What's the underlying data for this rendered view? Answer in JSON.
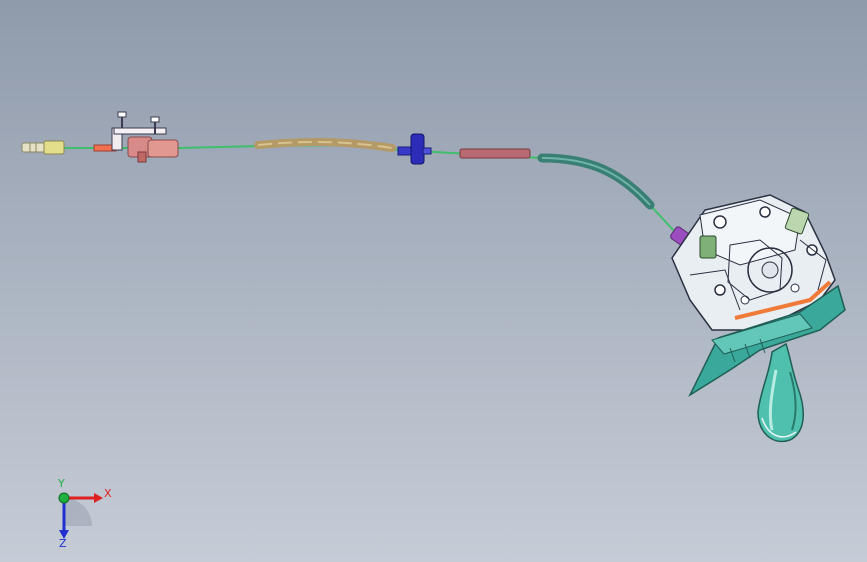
{
  "viewport": {
    "background_top": "#8f9aab",
    "background_bottom": "#c6ccd6"
  },
  "model": {
    "parts": [
      "cable-end-fitting",
      "cable-bracket",
      "inner-cable",
      "cable-sleeve",
      "grommet",
      "cable-conduit",
      "cable-clip",
      "shifter-assembly",
      "shift-lever",
      "mounting-base"
    ],
    "colors": {
      "cable": "#3fbf6a",
      "end_fitting": "#e8e0a0",
      "bracket": "#c07070",
      "sleeve": "#b49a66",
      "grommet": "#2c2cb8",
      "sleeve_red": "#b86a72",
      "conduit": "#3a7f74",
      "clip": "#9b4dbf",
      "shifter_body": "#e9eef3",
      "mount_base": "#3aa89a",
      "lever": "#4fc0ad",
      "accent_orange": "#f07a3a"
    }
  },
  "triad": {
    "x_label": "X",
    "y_label": "Y",
    "z_label": "Z",
    "x_color": "#e02020",
    "y_color": "#20b040",
    "z_color": "#2030d0"
  }
}
